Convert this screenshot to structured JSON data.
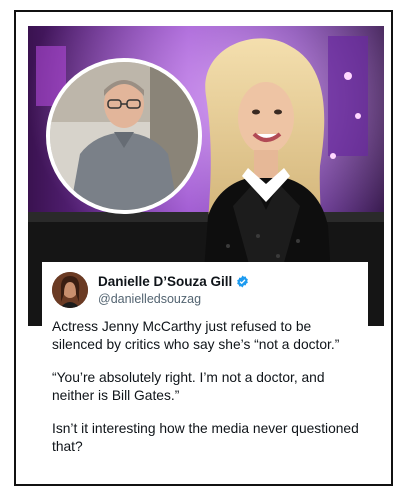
{
  "post": {
    "author_name": "Danielle D’Souza Gill",
    "author_handle": "@danielledsouzag",
    "verified_icon": "verified-badge-icon",
    "paragraphs": [
      "Actress Jenny McCarthy just refused to be silenced by critics who say she’s “not a doctor.”",
      "“You’re absolutely right. I’m not a doctor, and neither is Bill Gates.”",
      "Isn’t it interesting how the media never questioned that?"
    ]
  },
  "colors": {
    "verified_blue": "#1d9bf0",
    "handle_gray": "#536471",
    "text": "#0f1419",
    "stage_purple": "#7a2fb0"
  }
}
